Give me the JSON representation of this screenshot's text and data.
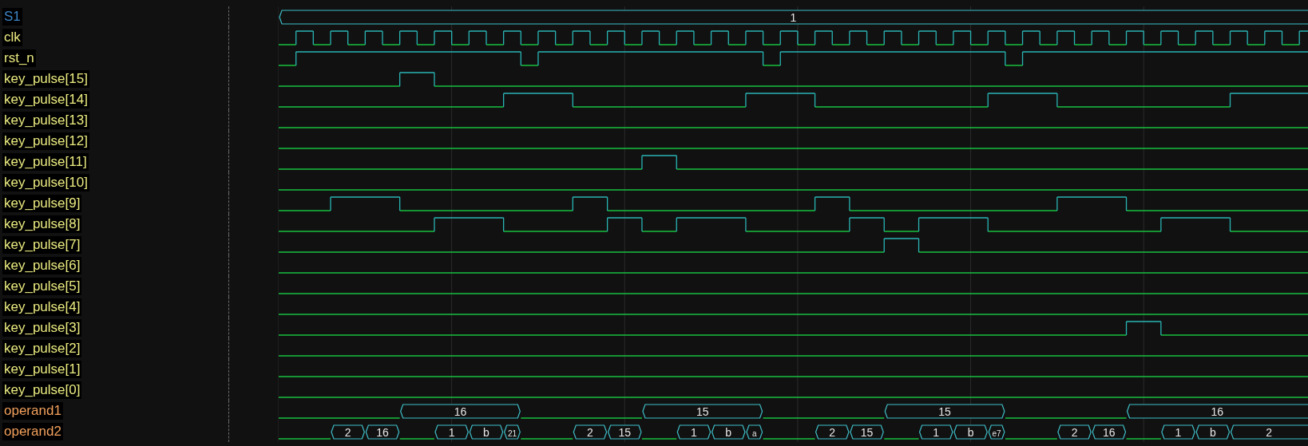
{
  "signals": [
    {
      "name": "S1",
      "kind": "group",
      "values": [
        "1"
      ]
    },
    {
      "name": "clk",
      "kind": "bit"
    },
    {
      "name": "rst_n",
      "kind": "bit"
    },
    {
      "name": "key_pulse[15]",
      "kind": "bit"
    },
    {
      "name": "key_pulse[14]",
      "kind": "bit"
    },
    {
      "name": "key_pulse[13]",
      "kind": "bit"
    },
    {
      "name": "key_pulse[12]",
      "kind": "bit"
    },
    {
      "name": "key_pulse[11]",
      "kind": "bit"
    },
    {
      "name": "key_pulse[10]",
      "kind": "bit"
    },
    {
      "name": "key_pulse[9]",
      "kind": "bit"
    },
    {
      "name": "key_pulse[8]",
      "kind": "bit"
    },
    {
      "name": "key_pulse[7]",
      "kind": "bit"
    },
    {
      "name": "key_pulse[6]",
      "kind": "bit"
    },
    {
      "name": "key_pulse[5]",
      "kind": "bit"
    },
    {
      "name": "key_pulse[4]",
      "kind": "bit"
    },
    {
      "name": "key_pulse[3]",
      "kind": "bit"
    },
    {
      "name": "key_pulse[2]",
      "kind": "bit"
    },
    {
      "name": "key_pulse[1]",
      "kind": "bit"
    },
    {
      "name": "key_pulse[0]",
      "kind": "bit"
    },
    {
      "name": "operand1",
      "kind": "bus",
      "values": [
        "16",
        "15",
        "15",
        "16"
      ]
    },
    {
      "name": "operand2",
      "kind": "bus",
      "values": [
        "2",
        "16",
        "1",
        "b",
        "21",
        "2",
        "15",
        "1",
        "b",
        "a",
        "2",
        "15",
        "1",
        "b",
        "e7",
        "2",
        "16",
        "1",
        "b",
        "2"
      ]
    }
  ]
}
